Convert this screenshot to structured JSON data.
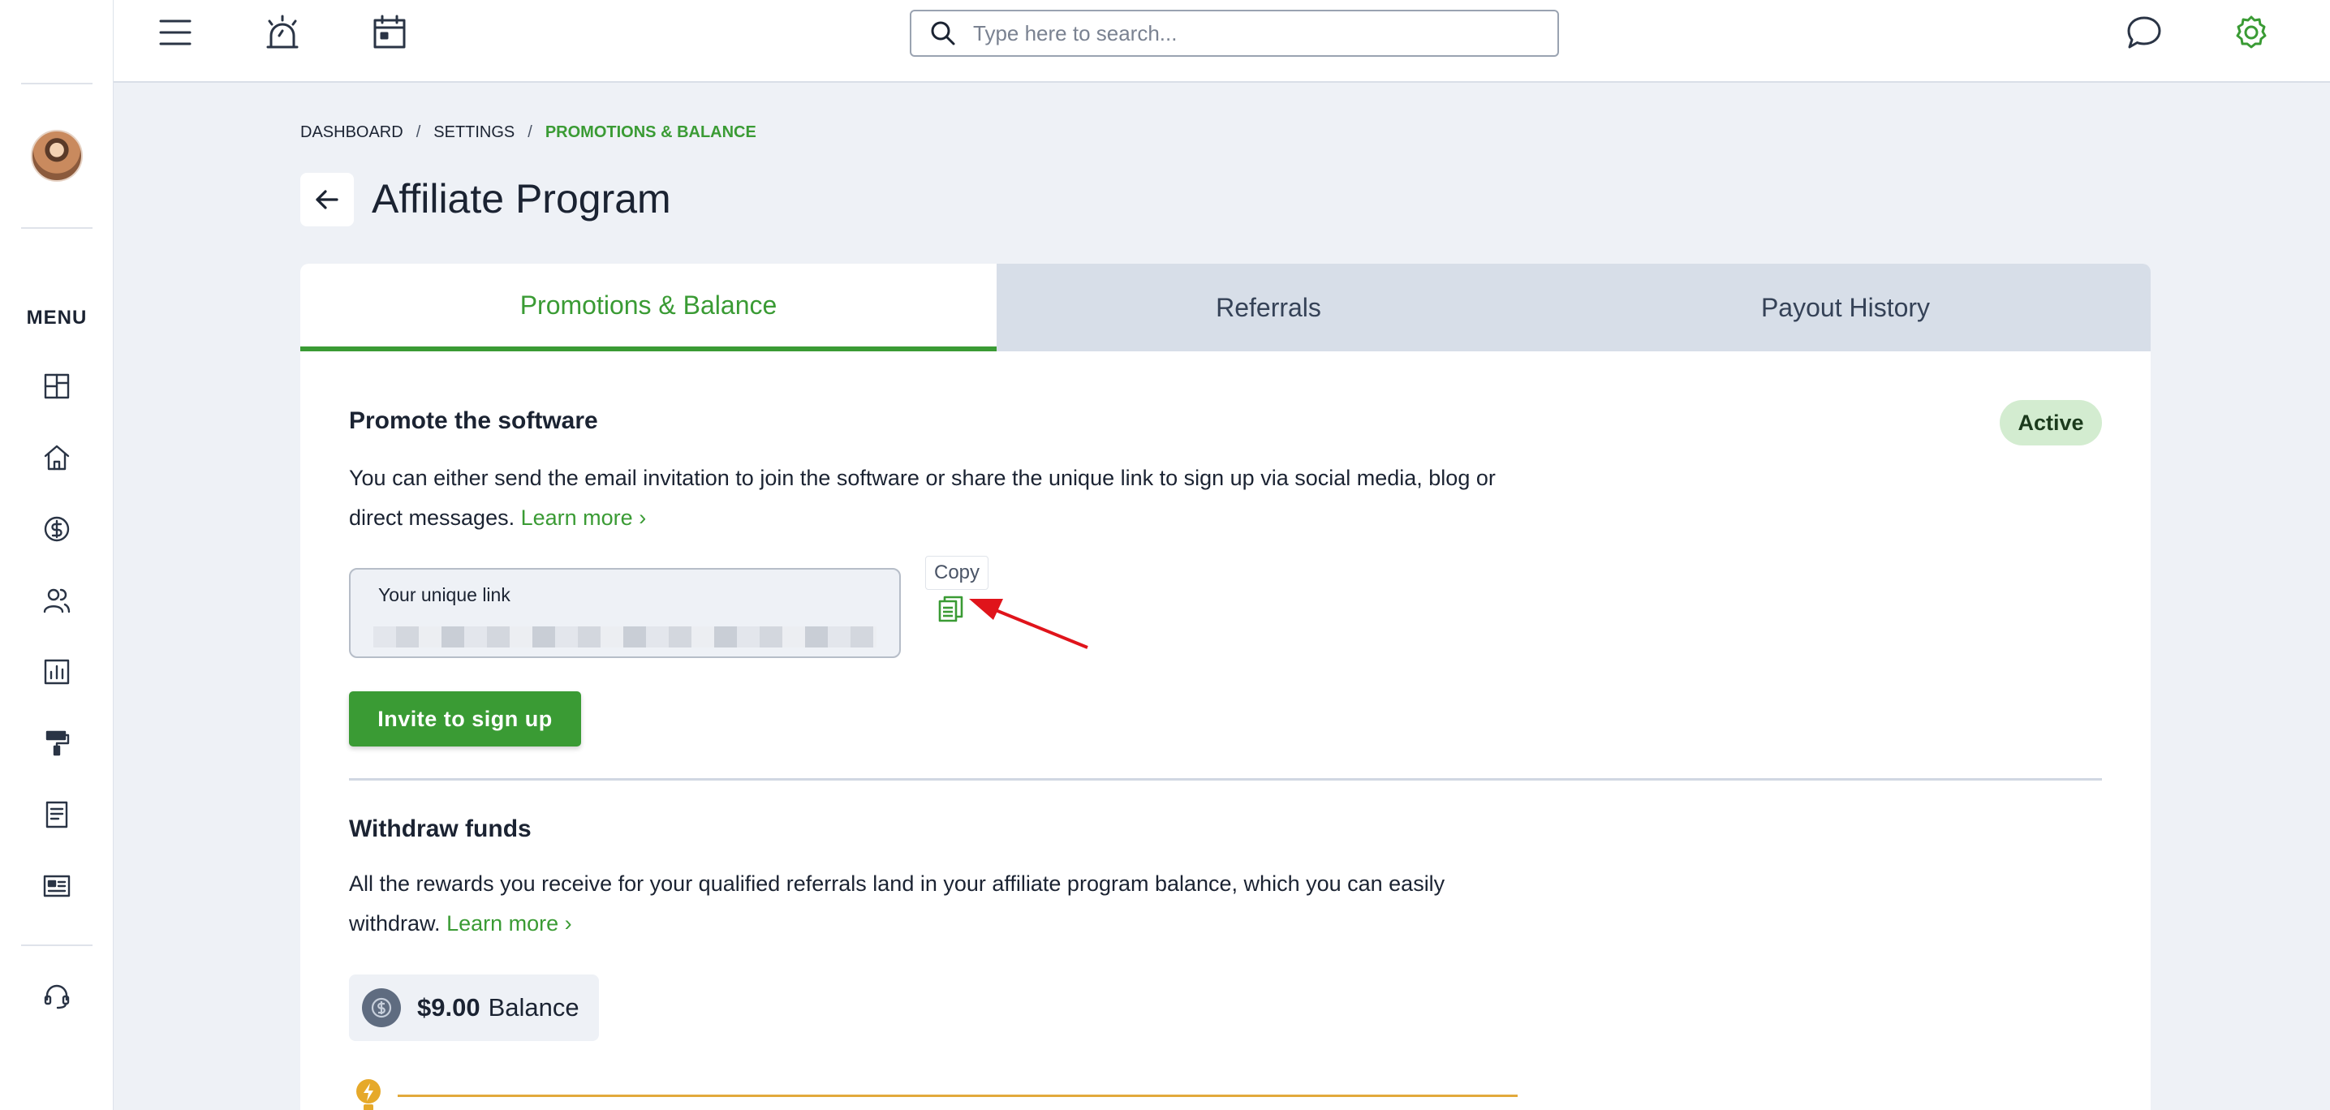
{
  "sidebar": {
    "menu_label": "MENU",
    "items": [
      {
        "icon": "dashboard-grid-icon"
      },
      {
        "icon": "home-icon"
      },
      {
        "icon": "dollar-circle-icon"
      },
      {
        "icon": "users-icon"
      },
      {
        "icon": "bar-chart-icon"
      },
      {
        "icon": "paint-roller-icon"
      },
      {
        "icon": "document-icon"
      },
      {
        "icon": "id-card-icon"
      }
    ],
    "support_icon": "headset-icon"
  },
  "topbar": {
    "icons": [
      "hamburger-menu-icon",
      "alarm-icon",
      "calendar-icon"
    ],
    "search_placeholder": "Type here to search...",
    "right_icons": [
      "chat-bubble-icon",
      "gear-icon"
    ]
  },
  "breadcrumb": {
    "items": [
      "DASHBOARD",
      "SETTINGS",
      "PROMOTIONS & BALANCE"
    ]
  },
  "page": {
    "title": "Affiliate Program"
  },
  "tabs": [
    {
      "label": "Promotions & Balance",
      "active": true
    },
    {
      "label": "Referrals",
      "active": false
    },
    {
      "label": "Payout History",
      "active": false
    }
  ],
  "promote": {
    "title": "Promote the software",
    "status": "Active",
    "description": "You can either send the email invitation to join the software or share the unique link to sign up via social media, blog or direct messages.",
    "learn_more": "Learn more",
    "link_label": "Your unique link",
    "copy_tooltip": "Copy",
    "invite_button": "Invite to sign up"
  },
  "withdraw": {
    "title": "Withdraw funds",
    "description": "All the rewards you receive for your qualified referrals land in your affiliate program balance, which you can easily withdraw.",
    "learn_more": "Learn more",
    "balance_amount": "$9.00",
    "balance_label": "Balance"
  },
  "colors": {
    "accent": "#3a9b34",
    "annotation_arrow": "#e0141b"
  }
}
